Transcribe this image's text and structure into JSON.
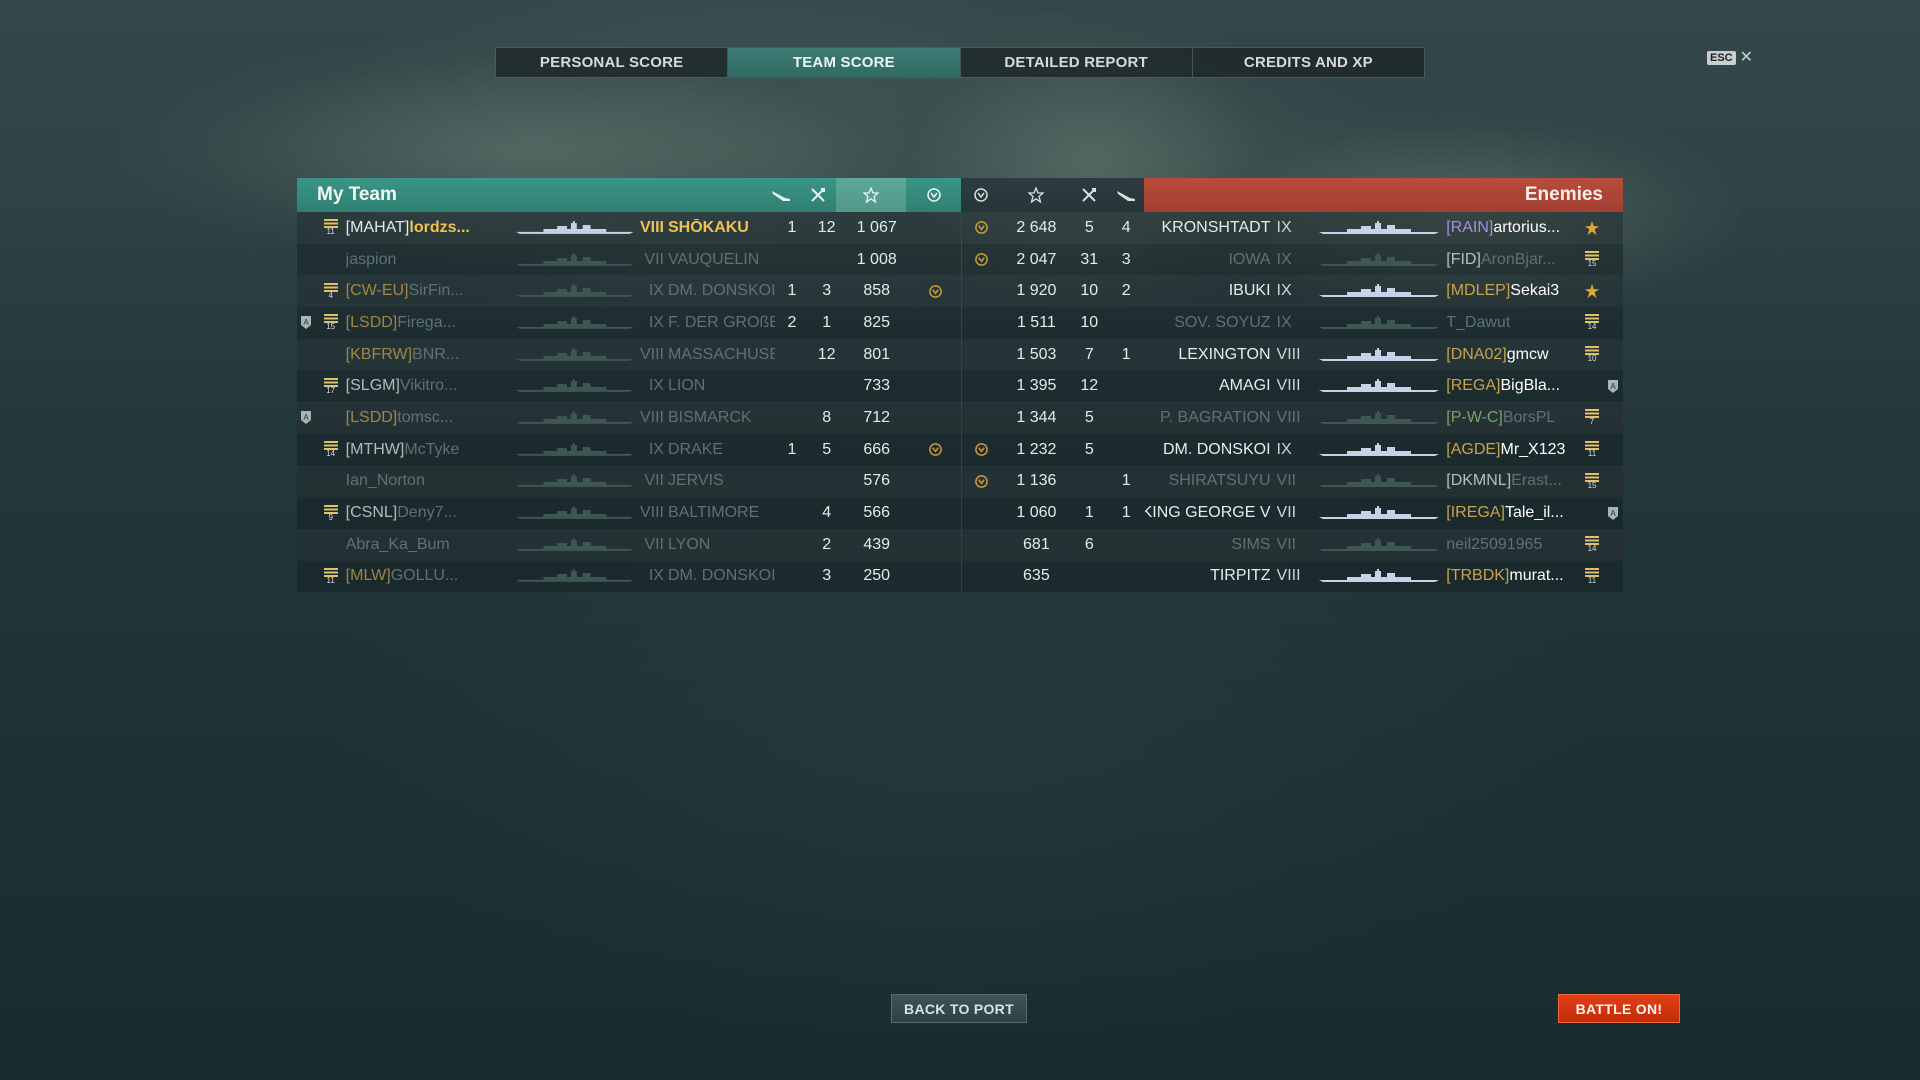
{
  "tabs": [
    {
      "label": "PERSONAL SCORE",
      "active": false
    },
    {
      "label": "TEAM SCORE",
      "active": true
    },
    {
      "label": "DETAILED REPORT",
      "active": false
    },
    {
      "label": "CREDITS AND XP",
      "active": false
    }
  ],
  "esc": {
    "key": "ESC",
    "close": "✕"
  },
  "my_team": {
    "title": "My Team",
    "columns_icons": [
      "planes-destroyed-icon",
      "frags-icon",
      "xp-star-icon",
      "achievement-icon"
    ]
  },
  "enemies": {
    "title": "Enemies",
    "columns_icons": [
      "achievement-icon",
      "xp-star-icon",
      "frags-icon",
      "planes-destroyed-icon"
    ]
  },
  "my_rows": [
    {
      "badge": "",
      "rank": "11",
      "clan": "[MAHAT]",
      "clan_color": "white",
      "name": "lordzs...",
      "tier": "VIII",
      "ship": "SHŌKAKU",
      "planes": "1",
      "frags": "12",
      "xp": "1 067",
      "ach": false,
      "dead": false,
      "me": true
    },
    {
      "badge": "",
      "rank": "",
      "clan": "",
      "clan_color": "white",
      "name": "jaspion",
      "tier": "VII",
      "ship": "VAUQUELIN",
      "planes": "",
      "frags": "",
      "xp": "1 008",
      "ach": false,
      "dead": true,
      "me": false
    },
    {
      "badge": "",
      "rank": "4",
      "clan": "[CW-EU]",
      "clan_color": "gold",
      "name": "SirFin...",
      "tier": "IX",
      "ship": "DM. DONSKOI",
      "planes": "1",
      "frags": "3",
      "xp": "858",
      "ach": true,
      "dead": true,
      "me": false
    },
    {
      "badge": "A",
      "rank": "15",
      "clan": "[LSDD]",
      "clan_color": "gold",
      "name": "Firega...",
      "tier": "IX",
      "ship": "F. DER GROßE",
      "planes": "2",
      "frags": "1",
      "xp": "825",
      "ach": false,
      "dead": true,
      "me": false
    },
    {
      "badge": "",
      "rank": "",
      "clan": "[KBFRW]",
      "clan_color": "gold",
      "name": "BNR...",
      "tier": "VIII",
      "ship": "MASSACHUSE...",
      "planes": "",
      "frags": "12",
      "xp": "801",
      "ach": false,
      "dead": true,
      "me": false
    },
    {
      "badge": "",
      "rank": "17",
      "clan": "[SLGM]",
      "clan_color": "white",
      "name": "Vikitro...",
      "tier": "IX",
      "ship": "LION",
      "planes": "",
      "frags": "",
      "xp": "733",
      "ach": false,
      "dead": true,
      "me": false
    },
    {
      "badge": "A",
      "rank": "",
      "clan": "[LSDD]",
      "clan_color": "gold",
      "name": "tomsc...",
      "tier": "VIII",
      "ship": "BISMARCK",
      "planes": "",
      "frags": "8",
      "xp": "712",
      "ach": false,
      "dead": true,
      "me": false
    },
    {
      "badge": "",
      "rank": "14",
      "clan": "[MTHW]",
      "clan_color": "white",
      "name": "McTyke",
      "tier": "IX",
      "ship": "DRAKE",
      "planes": "1",
      "frags": "5",
      "xp": "666",
      "ach": true,
      "dead": true,
      "me": false
    },
    {
      "badge": "",
      "rank": "",
      "clan": "",
      "clan_color": "white",
      "name": "Ian_Norton",
      "tier": "VII",
      "ship": "JERVIS",
      "planes": "",
      "frags": "",
      "xp": "576",
      "ach": false,
      "dead": true,
      "me": false
    },
    {
      "badge": "",
      "rank": "9",
      "clan": "[CSNL]",
      "clan_color": "white",
      "name": "Deny7...",
      "tier": "VIII",
      "ship": "BALTIMORE",
      "planes": "",
      "frags": "4",
      "xp": "566",
      "ach": false,
      "dead": true,
      "me": false
    },
    {
      "badge": "",
      "rank": "",
      "clan": "",
      "clan_color": "white",
      "name": "Abra_Ka_Bum",
      "tier": "VII",
      "ship": "LYON",
      "planes": "",
      "frags": "2",
      "xp": "439",
      "ach": false,
      "dead": true,
      "me": false
    },
    {
      "badge": "",
      "rank": "11",
      "clan": "[MLW]",
      "clan_color": "gold",
      "name": "GOLLU...",
      "tier": "IX",
      "ship": "DM. DONSKOI",
      "planes": "",
      "frags": "3",
      "xp": "250",
      "ach": false,
      "dead": true,
      "me": false
    }
  ],
  "enemy_rows": [
    {
      "ach": true,
      "xp": "2 648",
      "frags": "5",
      "planes": "4",
      "ship": "KRONSHTADT",
      "tier": "IX",
      "clan": "[RAIN]",
      "clan_color": "purple",
      "name": "artorius...",
      "rank": "star",
      "badge": "",
      "dead": false
    },
    {
      "ach": true,
      "xp": "2 047",
      "frags": "31",
      "planes": "3",
      "ship": "IOWA",
      "tier": "IX",
      "clan": "[FID]",
      "clan_color": "white",
      "name": "AronBjar...",
      "rank": "15",
      "badge": "",
      "dead": true
    },
    {
      "ach": false,
      "xp": "1 920",
      "frags": "10",
      "planes": "2",
      "ship": "IBUKI",
      "tier": "IX",
      "clan": "[MDLEP]",
      "clan_color": "gold",
      "name": "Sekai3",
      "rank": "star",
      "badge": "",
      "dead": false
    },
    {
      "ach": false,
      "xp": "1 511",
      "frags": "10",
      "planes": "",
      "ship": "SOV. SOYUZ",
      "tier": "IX",
      "clan": "",
      "clan_color": "white",
      "name": "T_Dawut",
      "rank": "14",
      "badge": "",
      "dead": true
    },
    {
      "ach": false,
      "xp": "1 503",
      "frags": "7",
      "planes": "1",
      "ship": "LEXINGTON",
      "tier": "VIII",
      "clan": "[DNA02]",
      "clan_color": "gold",
      "name": "gmcw",
      "rank": "10",
      "badge": "",
      "dead": false
    },
    {
      "ach": false,
      "xp": "1 395",
      "frags": "12",
      "planes": "",
      "ship": "AMAGI",
      "tier": "VIII",
      "clan": "[REGA]",
      "clan_color": "gold",
      "name": "BigBla...",
      "rank": "",
      "badge": "A",
      "dead": false
    },
    {
      "ach": false,
      "xp": "1 344",
      "frags": "5",
      "planes": "",
      "ship": "P. BAGRATION",
      "tier": "VIII",
      "clan": "[P-W-C]",
      "clan_color": "green",
      "name": "BorsPL",
      "rank": "7",
      "badge": "",
      "dead": true
    },
    {
      "ach": true,
      "xp": "1 232",
      "frags": "5",
      "planes": "",
      "ship": "DM. DONSKOI",
      "tier": "IX",
      "clan": "[AGDE]",
      "clan_color": "gold",
      "name": "Mr_X123",
      "rank": "11",
      "badge": "",
      "dead": false
    },
    {
      "ach": true,
      "xp": "1 136",
      "frags": "",
      "planes": "1",
      "ship": "SHIRATSUYU",
      "tier": "VII",
      "clan": "[DKMNL]",
      "clan_color": "white",
      "name": "Erast...",
      "rank": "15",
      "badge": "",
      "dead": true
    },
    {
      "ach": false,
      "xp": "1 060",
      "frags": "1",
      "planes": "1",
      "ship": "KING GEORGE V",
      "tier": "VII",
      "clan": "[IREGA]",
      "clan_color": "gold",
      "name": "Tale_il...",
      "rank": "",
      "badge": "A",
      "dead": false
    },
    {
      "ach": false,
      "xp": "681",
      "frags": "6",
      "planes": "",
      "ship": "SIMS",
      "tier": "VII",
      "clan": "",
      "clan_color": "white",
      "name": "neil25091965",
      "rank": "14",
      "badge": "",
      "dead": true
    },
    {
      "ach": false,
      "xp": "635",
      "frags": "",
      "planes": "",
      "ship": "TIRPITZ",
      "tier": "VIII",
      "clan": "[TRBDK]",
      "clan_color": "gold",
      "name": "murat...",
      "rank": "11",
      "badge": "",
      "dead": false
    }
  ],
  "buttons": {
    "back": "BACK TO PORT",
    "battle": "BATTLE ON!"
  },
  "colors": {
    "team": "#3a9586",
    "enemy": "#b84c3c",
    "battle_button": "#e23f16",
    "self_highlight": "#f0c152"
  }
}
